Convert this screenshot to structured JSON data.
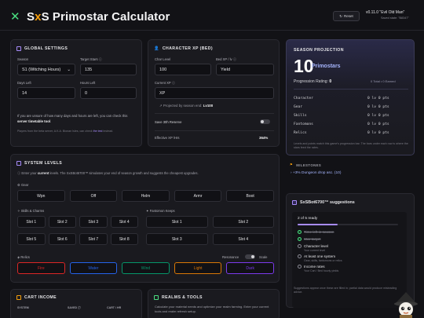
{
  "header": {
    "title_a": "S",
    "title_x": "x",
    "title_b": "S Primostar Calculator",
    "reset": "Reset",
    "version": "v0.11.0 \"Evil Old Man\"",
    "saved": "Saved state: \"B8347\""
  },
  "global": {
    "title": "GLOBAL SETTINGS",
    "season_label": "Season",
    "season_value": "S1 (Witching Hours)",
    "target_label": "Target Stars",
    "target_value": "135",
    "days_label": "Days Left",
    "days_value": "14",
    "hours_label": "Hours Left",
    "hours_value": "0",
    "note_pre": "If you are unsure of how many days and hours are left, you can check this ",
    "note_link": "server timetable tool",
    "note_post": ".",
    "footnote_pre": "Players from the beta server, A.K.A. Bionan Isles, can check ",
    "footnote_link": "the test",
    "footnote_post": " instead."
  },
  "character": {
    "title": "CHARACTER XP (BED)",
    "char_level_label": "Char Level",
    "char_level_value": "100",
    "bed_lv_label": "Bed XP / lv",
    "bed_lv_value": "Yield",
    "current_xp_label": "Current XP",
    "current_xp_value": "XP",
    "projected": "Projected by season end: ",
    "projected_value": "Lv100",
    "save_label": "Save 30h Reserve",
    "effective_label": "Effective XP /Hrs",
    "effective_value": "364%"
  },
  "projection": {
    "title": "SEASON PROJECTION",
    "big": "10",
    "big_label": "Primostars",
    "rating_label": "Progression Rating: ",
    "rating_value": "0",
    "earned": "0 Total • 0 Earned",
    "rows": [
      {
        "name": "Character",
        "a": "0",
        "b": "lv",
        "c": "0",
        "d": "pts"
      },
      {
        "name": "Gear",
        "a": "0",
        "b": "lv",
        "c": "0",
        "d": "pts"
      },
      {
        "name": "Skills",
        "a": "0",
        "b": "lv",
        "c": "0",
        "d": "pts"
      },
      {
        "name": "Fantomons",
        "a": "0",
        "b": "lv",
        "c": "0",
        "d": "pts"
      },
      {
        "name": "Relics",
        "a": "0",
        "b": "lv",
        "c": "0",
        "d": "pts"
      }
    ],
    "foot": "Levels and points match this game's progression bar. The bars under each row is where the stars feed the rates."
  },
  "milestones": {
    "title": "MILESTONES",
    "item": "+3% Dungeon drop asc. (10)"
  },
  "system": {
    "title": "SYSTEM LEVELS",
    "intro_pre": "Enter your ",
    "intro_bold": "current",
    "intro_post": " levels. The SxSBot6700™ simulates your end of season growth and suggests the cheapest upgrades.",
    "gear_label": "Gear",
    "gear": [
      "Wpn",
      "Off",
      "Helm",
      "Armr",
      "Boot"
    ],
    "skills_label": "Skills & Charms",
    "skills": [
      "Slot 1",
      "Slot 2",
      "Slot 3",
      "Slot 4",
      "Slot 5",
      "Slot 6",
      "Slot 7",
      "Slot 8"
    ],
    "fantomon_label": "Fantomon Keeps",
    "fantomons": [
      "Slot 1",
      "Slot 2",
      "Slot 3",
      "Slot 4"
    ],
    "relics_label": "Relics",
    "relic_toggle_a": "Resonance",
    "relic_toggle_b": "Scale",
    "relics": [
      "Fire",
      "Water",
      "Wind",
      "Light",
      "Dark"
    ],
    "relic_colors": [
      "#dc2626",
      "#2563eb",
      "#059669",
      "#d97706",
      "#7c3aed"
    ]
  },
  "suggestions": {
    "title": "SxSBot6700™ suggestions",
    "ready": "2 of 5 ready",
    "progress": 0.4,
    "items": [
      {
        "text": "Time left in season",
        "done": true
      },
      {
        "text": "Star target",
        "done": true
      },
      {
        "text": "Character level",
        "sub": "Your current level",
        "done": false
      },
      {
        "text": "At least one system",
        "sub": "Gear, skills, fantomons or relics",
        "done": false
      },
      {
        "text": "Income rates",
        "sub": "Your Cart / Bed hourly yields",
        "done": false
      }
    ],
    "foot": "Suggestions appear once these are filled in; partial data would produce misleading advice."
  },
  "cart": {
    "title": "CART INCOME",
    "col_system": "SYSTEM",
    "col_saved": "SAVED",
    "col_rate": "CART / HR"
  },
  "realms": {
    "title": "REALMS & TOOLS",
    "text": "Calculate your material needs and optimize your realm farming. Enter your current tools and realm refresh setup."
  }
}
